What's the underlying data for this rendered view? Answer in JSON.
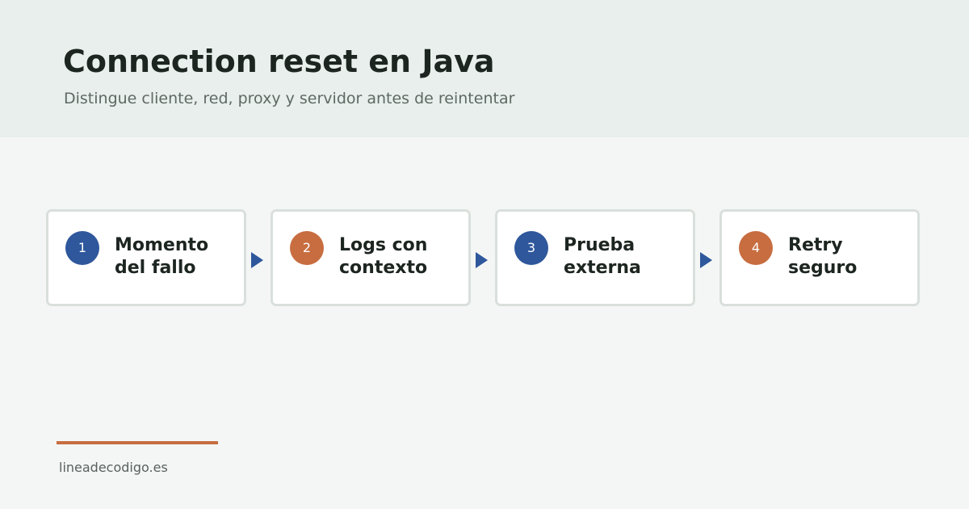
{
  "header": {
    "title": "Connection reset en Java",
    "subtitle": "Distingue cliente, red, proxy y servidor antes de reintentar"
  },
  "steps": [
    {
      "number": "1",
      "label": "Momento del fallo"
    },
    {
      "number": "2",
      "label": "Logs con contexto"
    },
    {
      "number": "3",
      "label": "Prueba externa"
    },
    {
      "number": "4",
      "label": "Retry seguro"
    }
  ],
  "footer": {
    "site": "lineadecodigo.es"
  },
  "colors": {
    "blue": "#2e579c",
    "orange": "#c76d40"
  }
}
